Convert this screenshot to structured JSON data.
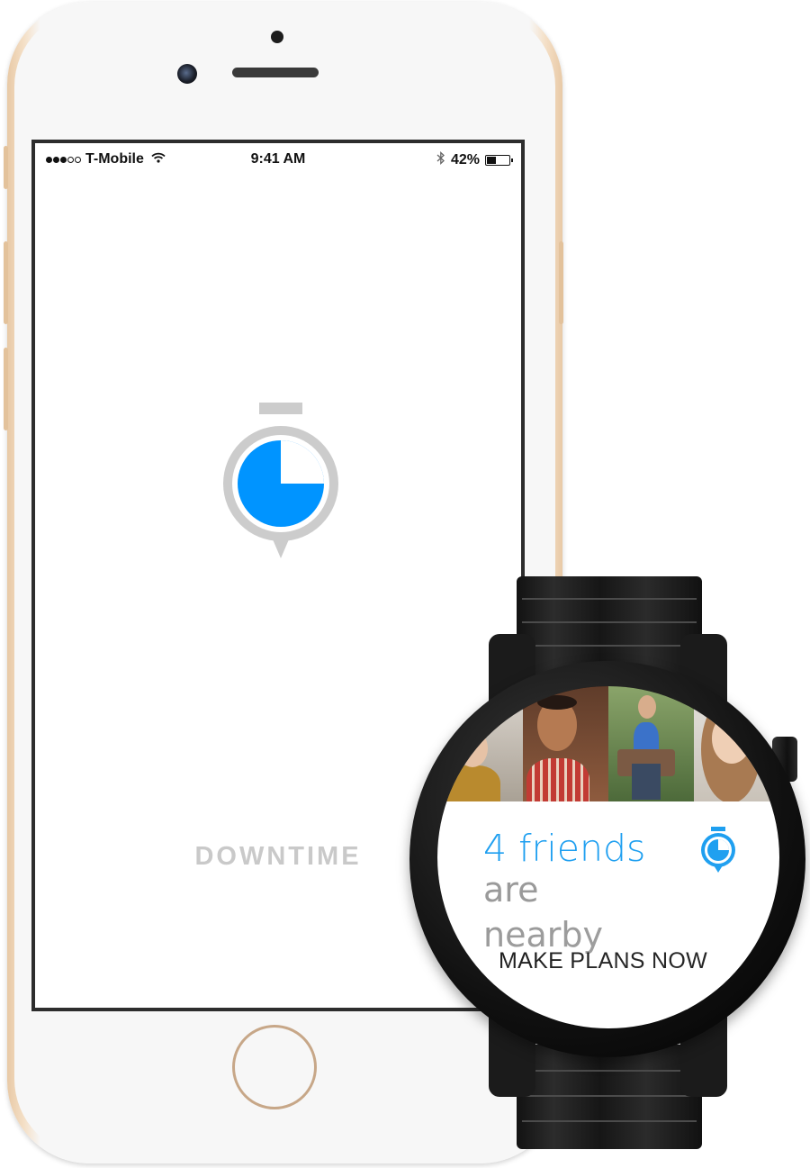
{
  "phone": {
    "status_bar": {
      "carrier": "T-Mobile",
      "signal_bars_filled": 3,
      "signal_bars_total": 5,
      "time": "9:41 AM",
      "battery_percent_label": "42%",
      "battery_level": 0.42,
      "icons": [
        "signal-icon",
        "wifi-icon",
        "bluetooth-icon",
        "battery-icon"
      ]
    },
    "app": {
      "name": "DOWNTIME",
      "logo_icon": "stopwatch-icon",
      "accent_color": "#0094ff",
      "logo_ring_color": "#cccccc"
    }
  },
  "watch": {
    "photos": [
      "friend-photo-1",
      "friend-photo-2",
      "friend-photo-3",
      "friend-photo-4"
    ],
    "notification": {
      "headline": "4 friends",
      "line2": "are",
      "line3": "nearby",
      "action": "MAKE PLANS NOW",
      "icon": "stopwatch-icon"
    },
    "accent_color": "#1e9ff0"
  }
}
